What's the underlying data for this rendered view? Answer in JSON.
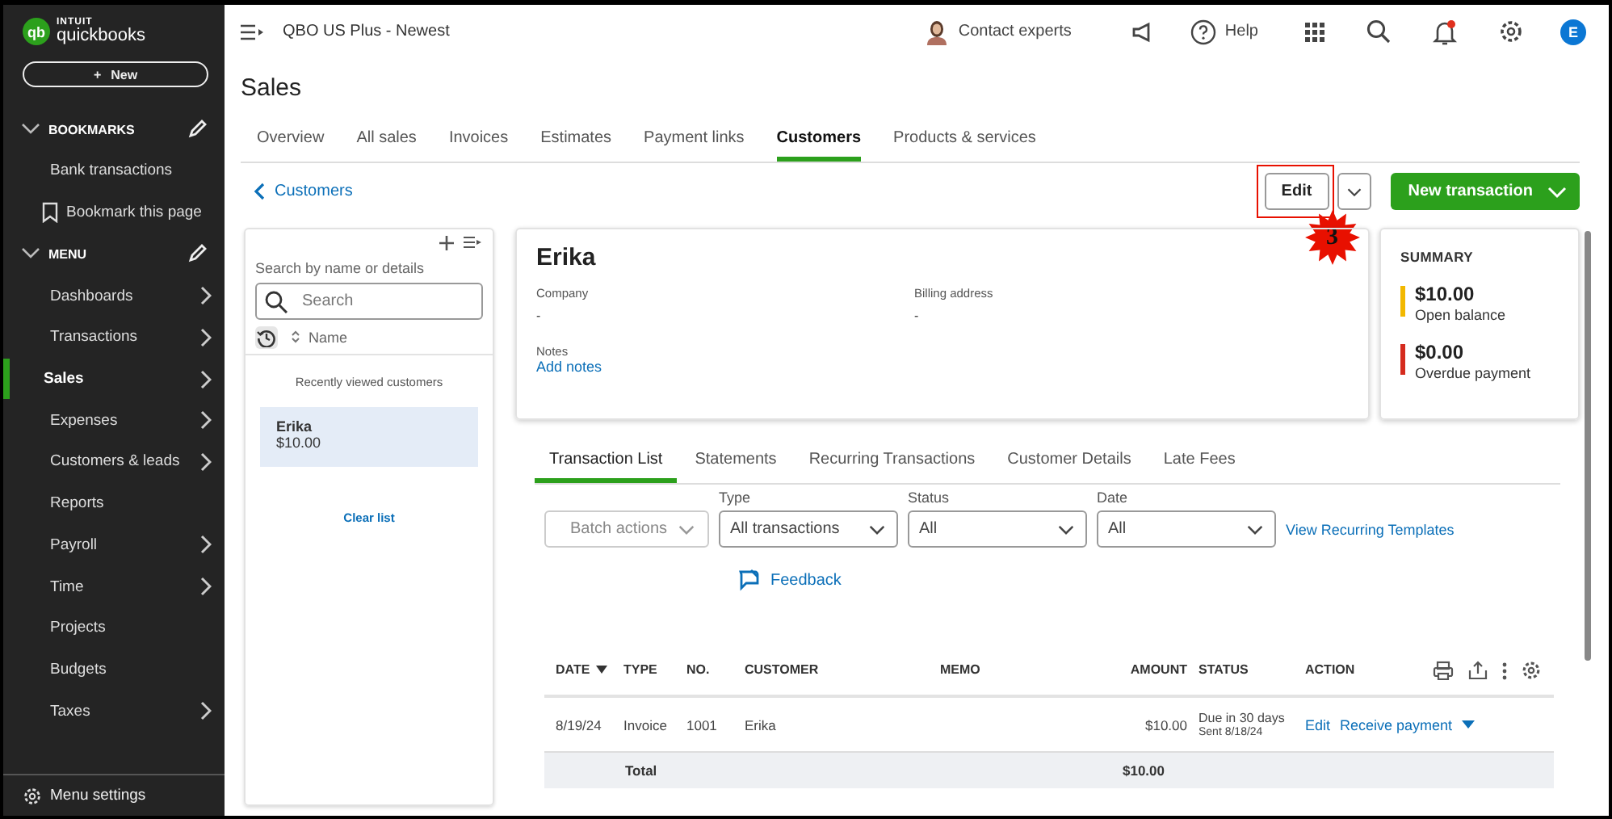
{
  "sidebar": {
    "logo": {
      "brand_top": "INTUIT",
      "brand": "quickbooks",
      "mark": "qb"
    },
    "new_button": {
      "icon": "+",
      "label": "New"
    },
    "sections": [
      {
        "title": "BOOKMARKS",
        "expanded": true,
        "items": [
          {
            "label": "Bank transactions",
            "selected": false,
            "expandable": false
          },
          {
            "label": "Bookmark this page",
            "selected": false,
            "expandable": false,
            "kind": "bookmark"
          }
        ]
      },
      {
        "title": "MENU",
        "expanded": true,
        "items": [
          {
            "label": "Dashboards",
            "selected": false,
            "expandable": true
          },
          {
            "label": "Transactions",
            "selected": false,
            "expandable": true
          },
          {
            "label": "Sales",
            "selected": true,
            "expandable": true
          },
          {
            "label": "Expenses",
            "selected": false,
            "expandable": true
          },
          {
            "label": "Customers & leads",
            "selected": false,
            "expandable": true
          },
          {
            "label": "Reports",
            "selected": false,
            "expandable": false
          },
          {
            "label": "Payroll",
            "selected": false,
            "expandable": true
          },
          {
            "label": "Time",
            "selected": false,
            "expandable": true
          },
          {
            "label": "Projects",
            "selected": false,
            "expandable": false
          },
          {
            "label": "Budgets",
            "selected": false,
            "expandable": false
          },
          {
            "label": "Taxes",
            "selected": false,
            "expandable": true
          }
        ]
      }
    ],
    "footer": "Menu settings"
  },
  "topbar": {
    "company": "QBO US Plus - Newest",
    "contact": "Contact experts",
    "help": "Help",
    "user_initial": "E",
    "notification": true
  },
  "page": {
    "title": "Sales",
    "tabs": [
      {
        "label": "Overview",
        "selected": false
      },
      {
        "label": "All sales",
        "selected": false
      },
      {
        "label": "Invoices",
        "selected": false
      },
      {
        "label": "Estimates",
        "selected": false
      },
      {
        "label": "Payment links",
        "selected": false
      },
      {
        "label": "Customers",
        "selected": true
      },
      {
        "label": "Products & services",
        "selected": false
      }
    ],
    "back_link": "Customers",
    "actions": {
      "edit": "Edit",
      "new_transaction": "New transaction"
    },
    "annotation": {
      "label": "3"
    }
  },
  "customer_list": {
    "search_label": "Search by name or details",
    "placeholder": "Search",
    "sort_label": "Name",
    "recent_title": "Recently viewed customers",
    "customers": [
      {
        "name": "Erika",
        "balance": "$10.00",
        "selected": true
      }
    ],
    "clear": "Clear list"
  },
  "profile": {
    "name": "Erika",
    "fields": [
      {
        "label": "Company",
        "value": "-"
      },
      {
        "label": "Billing address",
        "value": "-"
      }
    ],
    "notes_label": "Notes",
    "notes_link": "Add notes"
  },
  "summary": {
    "title": "SUMMARY",
    "items": [
      {
        "amount": "$10.00",
        "label": "Open balance",
        "color": "#f2b800"
      },
      {
        "amount": "$0.00",
        "label": "Overdue payment",
        "color": "#d52b1e"
      }
    ]
  },
  "detail_tabs": [
    {
      "label": "Transaction List",
      "selected": true
    },
    {
      "label": "Statements",
      "selected": false
    },
    {
      "label": "Recurring Transactions",
      "selected": false
    },
    {
      "label": "Customer Details",
      "selected": false
    },
    {
      "label": "Late Fees",
      "selected": false
    }
  ],
  "filters": {
    "batch": "Batch actions",
    "selects": [
      {
        "label": "Type",
        "value": "All transactions"
      },
      {
        "label": "Status",
        "value": "All"
      },
      {
        "label": "Date",
        "value": "All"
      }
    ],
    "templates_link": "View Recurring Templates",
    "feedback": "Feedback"
  },
  "table": {
    "columns": [
      {
        "label": "DATE",
        "sorted": true
      },
      {
        "label": "TYPE",
        "sorted": false
      },
      {
        "label": "NO.",
        "sorted": false
      },
      {
        "label": "CUSTOMER",
        "sorted": false
      },
      {
        "label": "MEMO",
        "sorted": false
      },
      {
        "label": "AMOUNT",
        "sorted": false
      },
      {
        "label": "STATUS",
        "sorted": false
      },
      {
        "label": "ACTION",
        "sorted": false
      }
    ],
    "rows": [
      {
        "date": "8/19/24",
        "type": "Invoice",
        "no": "1001",
        "customer": "Erika",
        "amount": "$10.00",
        "status": "Due in 30 days",
        "status_note": "Sent 8/18/24",
        "action": "Edit",
        "action_more": "Receive payment"
      }
    ],
    "total": {
      "label": "Total",
      "amount": "$10.00"
    }
  }
}
